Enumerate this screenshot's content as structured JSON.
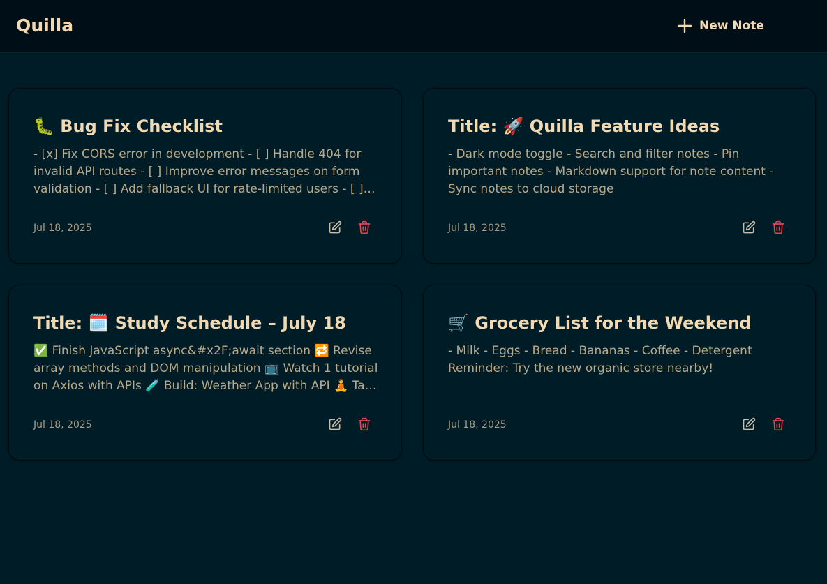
{
  "app": {
    "brand": "Quilla",
    "new_note_label": "New Note"
  },
  "notes": [
    {
      "title": "🐛 Bug Fix Checklist",
      "body": "- [x] Fix CORS error in development - [ ] Handle 404 for invalid API routes - [ ] Improve error messages on form validation - [ ] Add fallback UI for rate-limited users - [ ] Prevent empty note submission",
      "date": "Jul 18, 2025"
    },
    {
      "title": "Title: 🚀 Quilla Feature Ideas",
      "body": "- Dark mode toggle - Search and filter notes - Pin important notes - Markdown support for note content - Sync notes to cloud storage",
      "date": "Jul 18, 2025"
    },
    {
      "title": "Title: 🗓️ Study Schedule – July 18",
      "body": "✅ Finish JavaScript async&#x2F;await section 🔁 Revise array methods and DOM manipulation 📺 Watch 1 tutorial on Axios with APIs 🧪 Build: Weather App with API 🧘 Take breaks every hour",
      "date": "Jul 18, 2025"
    },
    {
      "title": "🛒 Grocery List for the Weekend",
      "body": "- Milk - Eggs - Bread - Bananas - Coffee - Detergent Reminder: Try the new organic store nearby!",
      "date": "Jul 18, 2025"
    }
  ],
  "icons": {
    "new_note": "plus-icon",
    "edit": "edit-icon",
    "delete": "trash-icon"
  },
  "colors": {
    "background": "#001c26",
    "topbar": "#000f17",
    "accent_text": "#f3d9b1",
    "body_text": "#b9a989",
    "delete_red": "#e0454f",
    "edit_gray": "#c9bda8"
  }
}
